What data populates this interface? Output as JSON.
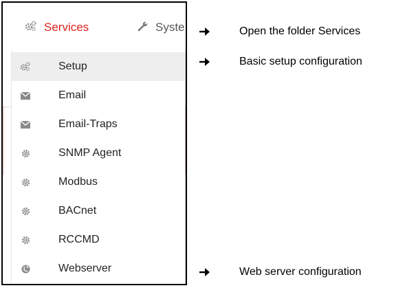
{
  "topbar": {
    "services_label": "Services",
    "system_label": "Syste",
    "accent_color": "#e0241b"
  },
  "menu": {
    "items": [
      {
        "label": "Setup",
        "icon": "cogs-icon",
        "active": true
      },
      {
        "label": "Email",
        "icon": "envelope-icon"
      },
      {
        "label": "Email-Traps",
        "icon": "envelope-icon"
      },
      {
        "label": "SNMP Agent",
        "icon": "gear-icon"
      },
      {
        "label": "Modbus",
        "icon": "gear-icon"
      },
      {
        "label": "BACnet",
        "icon": "gear-icon"
      },
      {
        "label": "RCCMD",
        "icon": "gear-icon"
      },
      {
        "label": "Webserver",
        "icon": "globe-icon"
      }
    ]
  },
  "annotations": [
    {
      "text": "Open the folder Services",
      "arrow": "➔"
    },
    {
      "text": "Basic setup configuration",
      "arrow": "➔"
    },
    {
      "text": "Web server configuration",
      "arrow": "➔"
    }
  ]
}
